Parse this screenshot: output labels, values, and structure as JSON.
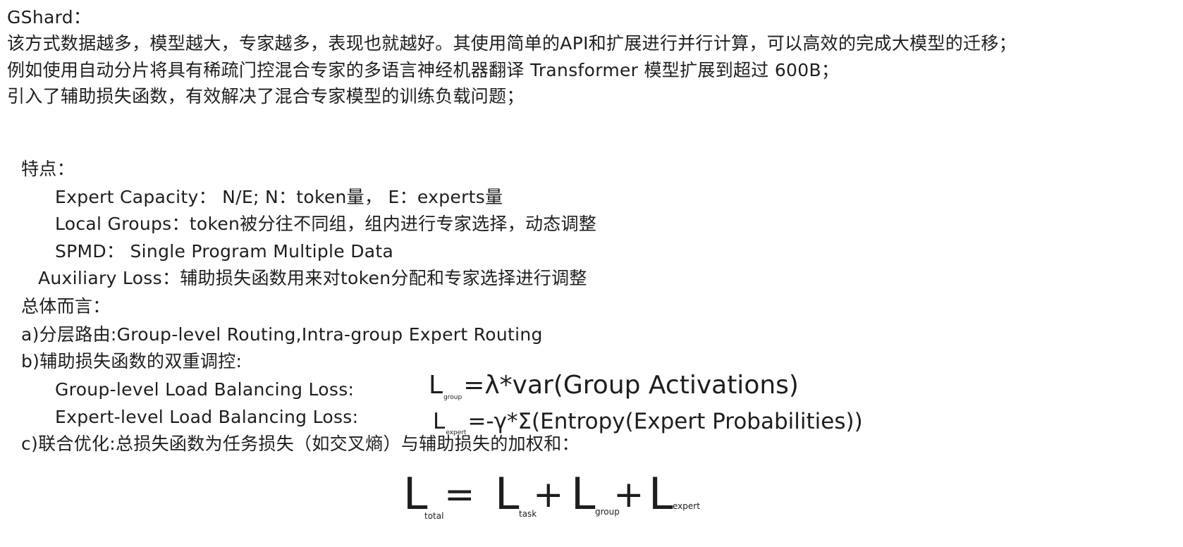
{
  "title": "GShard：",
  "intro": [
    "该方式数据越多，模型越大，专家越多，表现也就越好。其使用简单的API和扩展进行并行计算，可以高效的完成大模型的迁移；",
    "例如使用自动分片将具有稀疏门控混合专家的多语言神经机器翻译 Transformer 模型扩展到超过 600B；",
    "引入了辅助损失函数，有效解决了混合专家模型的训练负载问题；"
  ],
  "features": {
    "heading": "特点：",
    "items": [
      "Expert Capacity： N/E; N：token量，  E：experts量",
      "Local Groups：token被分往不同组，组内进行专家选择，动态调整",
      "SPMD： Single Program Multiple Data",
      "Auxiliary Loss：辅助损失函数用来对token分配和专家选择进行调整"
    ]
  },
  "overall": {
    "heading": "总体而言：",
    "a": "a)分层路由:Group-level Routing,Intra-group Expert Routing",
    "b": "b)辅助损失函数的双重调控:",
    "group_loss_label": "Group-level Load Balancing Loss:",
    "group_loss_formula": {
      "L": "L",
      "sub": "group",
      "rhs": "=λ*var(Group Activations)"
    },
    "expert_loss_label": "Expert-level Load Balancing Loss:",
    "expert_loss_formula": {
      "L": "L",
      "sub": "expert",
      "rhs": "=-γ*Σ(Entropy(Expert Probabilities))"
    },
    "c": "c)联合优化:总损失函数为任务损失（如交叉熵）与辅助损失的加权和："
  },
  "total_formula": {
    "L": "L",
    "eq": "=",
    "plus": "+",
    "sub_total": "total",
    "sub_task": "task",
    "sub_group": "group",
    "sub_expert": "expert"
  }
}
